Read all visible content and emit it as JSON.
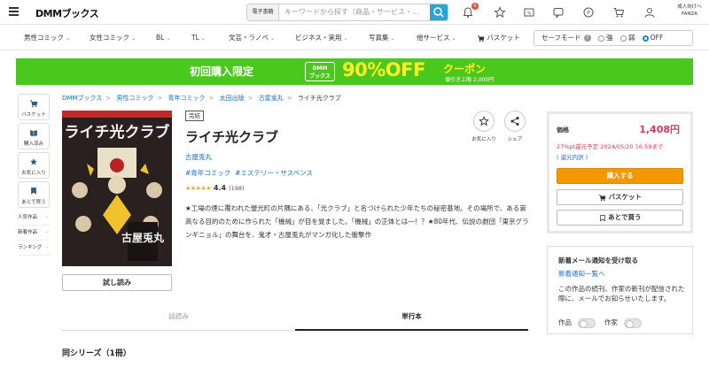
{
  "header": {
    "logo": "DMMブックス",
    "search_category": "電子書籍",
    "search_placeholder": "キーワードから探す（商品・サービス・...",
    "notification_count": "6",
    "adult_label_line1": "成人向けへ",
    "adult_label_line2": "FANZA"
  },
  "nav": {
    "items": [
      {
        "label": "男性コミック"
      },
      {
        "label": "女性コミック"
      },
      {
        "label": "BL"
      },
      {
        "label": "TL"
      },
      {
        "label": "文芸・ラノベ"
      },
      {
        "label": "ビジネス・実用"
      },
      {
        "label": "写真集"
      },
      {
        "label": "他サービス"
      }
    ],
    "basket": "バスケット",
    "safe_mode": {
      "label": "セーフモード",
      "options": [
        "強",
        "弱",
        "OFF"
      ],
      "selected": "OFF"
    }
  },
  "banner": {
    "first_purchase": "初回購入限定",
    "brand_line1": "DMM",
    "brand_line2": "ブックス",
    "discount": "90%OFF",
    "coupon": "クーポン",
    "limit": "値引き上限 2,000円"
  },
  "leftbar": {
    "buttons": [
      {
        "label": "バスケット",
        "icon": "cart-icon"
      },
      {
        "label": "購入済み",
        "icon": "book-icon"
      },
      {
        "label": "お気に入り",
        "icon": "star-icon"
      },
      {
        "label": "あとで買う",
        "icon": "bookmark-icon"
      }
    ],
    "links": [
      {
        "label": "人気作品"
      },
      {
        "label": "新着作品"
      },
      {
        "label": "ランキング"
      }
    ]
  },
  "breadcrumb": [
    "DMMブックス",
    "男性コミック",
    "青年コミック",
    "太田出版",
    "古屋兎丸",
    "ライチ光クラブ"
  ],
  "product": {
    "status": "完結",
    "title": "ライチ光クラブ",
    "author": "古屋兎丸",
    "tags": [
      "#青年コミック",
      "#ミステリー・サスペンス"
    ],
    "rating": 4.4,
    "rating_value": "4.4",
    "review_count": "(198)",
    "stars": "★★★★★",
    "description": "★工場の煙に覆われた螢光町の片隅にある、「光クラブ」と名づけられた少年たちの秘密基地。その場所で、ある崇高なる目的のために作られた「機械」が目を覚ました。「機械」の正体とは―！？★80年代、伝説の劇団「東京グランギニョル」の舞台を、鬼才・古屋兎丸がマンガ化した衝撃作",
    "trial_button": "試し読み",
    "favorite_label": "お気に入り",
    "share_label": "シェア",
    "cover_title": "ライチ光クラブ",
    "cover_author": "古屋兎丸"
  },
  "tabs": [
    {
      "label": "話読み"
    },
    {
      "label": "単行本"
    }
  ],
  "series_heading": "同シリーズ（1冊）",
  "buybox": {
    "price_label": "価格",
    "price": "1,408円",
    "points": "27%pt還元予定 2024/05/20 16:59まで",
    "points_detail": "( 還元内訳 )",
    "buy_button": "購入する",
    "basket_button": "バスケット",
    "later_button": "あとで買う"
  },
  "notify": {
    "heading": "新着メール通知を受け取る",
    "link": "新着通知一覧へ",
    "description": "この作品の続刊、作家の新刊が配信された際に、メールでお知らせいたします。",
    "toggle_work": "作品",
    "toggle_author": "作家"
  },
  "colors": {
    "accent": "#4bc81d",
    "price": "#d73a5d",
    "buy": "#f39800",
    "link": "#1a6fc4"
  }
}
